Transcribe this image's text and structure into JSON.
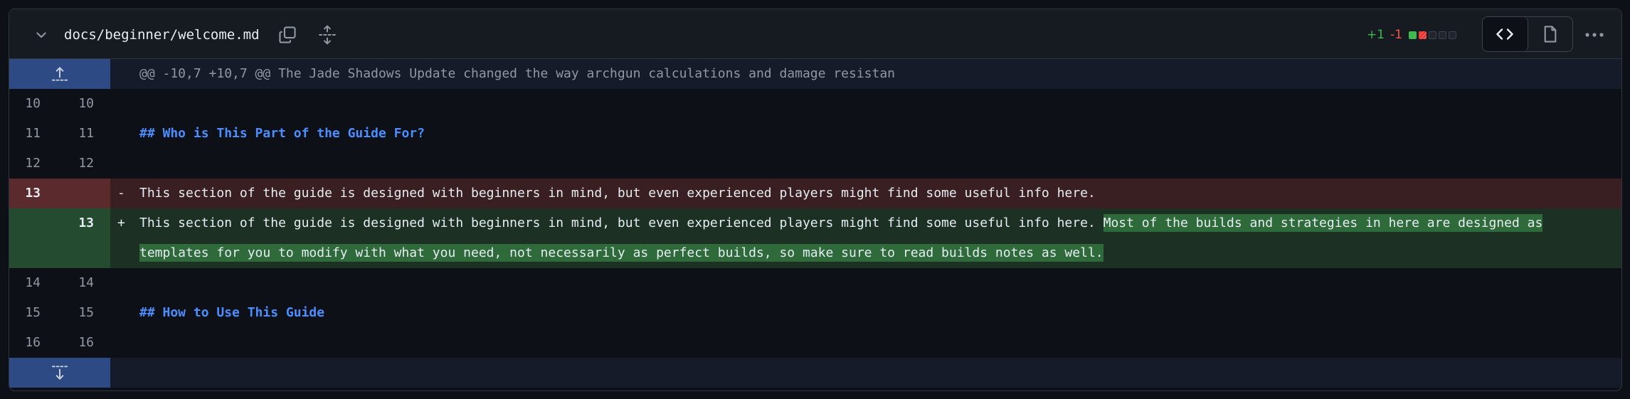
{
  "file": {
    "path": "docs/beginner/welcome.md",
    "additions": "+1",
    "deletions": "-1"
  },
  "diffstat_blocks": [
    "green",
    "red",
    "neutral",
    "neutral",
    "neutral"
  ],
  "colors": {
    "addition": "#3fb950",
    "deletion": "#f85149",
    "heading": "#4c8eff",
    "hunk_gutter": "#2d4a85"
  },
  "hunk": {
    "header": "@@ -10,7 +10,7 @@ The Jade Shadows Update changed the way archgun calculations and damage resistan"
  },
  "lines": {
    "l10": {
      "old": "10",
      "new": "10",
      "text": ""
    },
    "l11": {
      "old": "11",
      "new": "11",
      "text": "## Who is This Part of the Guide For?"
    },
    "l12": {
      "old": "12",
      "new": "12",
      "text": ""
    },
    "del13": {
      "old": "13",
      "marker": "-",
      "text": "This section of the guide is designed with beginners in mind, but even experienced players might find some useful info here."
    },
    "add13": {
      "new": "13",
      "marker": "+",
      "text_common": "This section of the guide is designed with beginners in mind, but even experienced players might find some useful info here. ",
      "text_added": "Most of the builds and strategies in here are designed as templates for you to modify with what you need, not necessarily as perfect builds, so make sure to read builds notes as well. "
    },
    "l14": {
      "old": "14",
      "new": "14",
      "text": ""
    },
    "l15": {
      "old": "15",
      "new": "15",
      "text": "## How to Use This Guide"
    },
    "l16": {
      "old": "16",
      "new": "16",
      "text": ""
    }
  },
  "icons": {
    "collapse": "chevron-down-icon",
    "copy": "copy-icon",
    "expand_all": "expand-all-icon",
    "code_view": "code-icon",
    "file_view": "file-icon",
    "more": "kebab-horizontal-icon",
    "expand_up": "expand-up-icon",
    "expand_down": "expand-down-icon"
  }
}
